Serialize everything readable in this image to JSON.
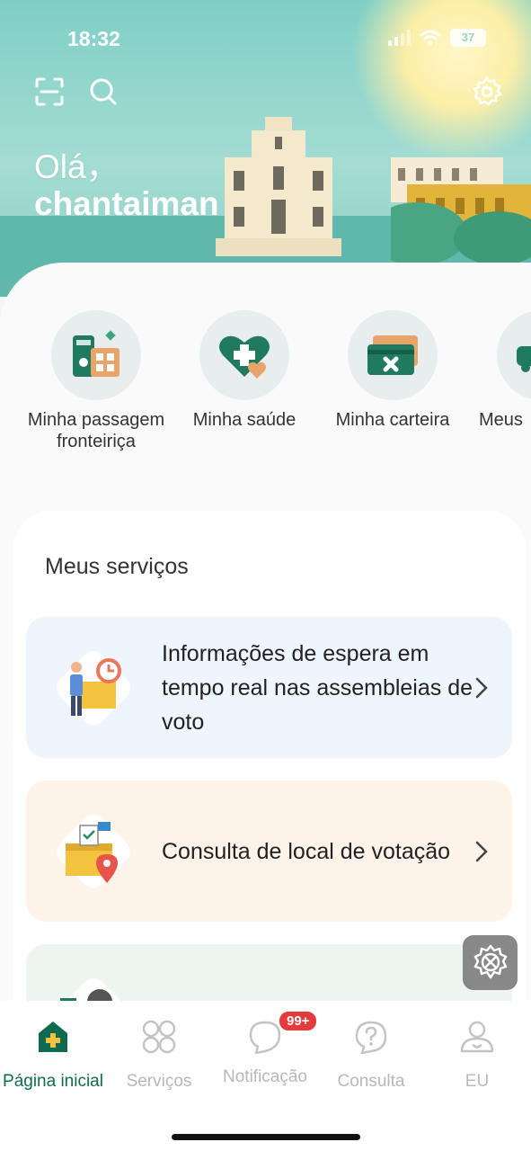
{
  "status_bar": {
    "time": "18:32",
    "battery": "37"
  },
  "header": {
    "greeting": "Olá，",
    "username": "chantaiman",
    "icons": [
      "scan-icon",
      "search-icon",
      "settings-icon"
    ]
  },
  "quick_actions": [
    {
      "label": "Minha passagem fronteiriça",
      "icon": "border-pass-icon"
    },
    {
      "label": "Minha saúde",
      "icon": "health-heart-icon"
    },
    {
      "label": "Minha carteira",
      "icon": "wallet-card-icon"
    },
    {
      "label": "Meus",
      "icon": "car-icon"
    }
  ],
  "services": {
    "title": "Meus serviços",
    "items": [
      {
        "label": "Informações de espera em tempo real nas assembleias de voto",
        "icon": "voting-wait-icon"
      },
      {
        "label": "Consulta de local de votação",
        "icon": "voting-location-icon"
      }
    ]
  },
  "tabbar": {
    "items": [
      {
        "label": "Página inicial",
        "active": true,
        "icon": "home-icon"
      },
      {
        "label": "Serviços",
        "active": false,
        "icon": "services-grid-icon"
      },
      {
        "label": "Notificação",
        "active": false,
        "icon": "notification-icon",
        "badge": "99+"
      },
      {
        "label": "Consulta",
        "active": false,
        "icon": "question-icon"
      },
      {
        "label": "EU",
        "active": false,
        "icon": "profile-icon"
      }
    ]
  },
  "colors": {
    "accent": "#0e6b52",
    "header": "#8fd4ca",
    "badge": "#e53a3a"
  }
}
